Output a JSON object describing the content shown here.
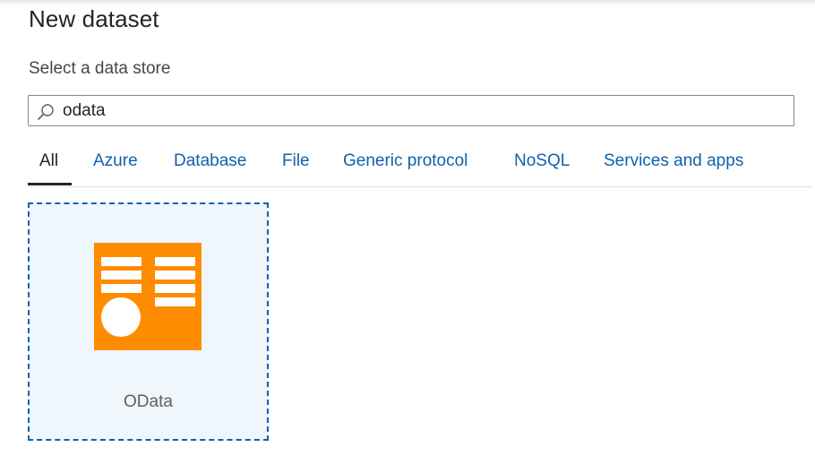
{
  "dialog": {
    "title": "New dataset",
    "subtitle": "Select a data store"
  },
  "search": {
    "value": "odata",
    "icon": "search-icon"
  },
  "tabs": [
    {
      "label": "All",
      "active": true
    },
    {
      "label": "Azure",
      "active": false
    },
    {
      "label": "Database",
      "active": false
    },
    {
      "label": "File",
      "active": false
    },
    {
      "label": "Generic protocol",
      "active": false
    },
    {
      "label": "NoSQL",
      "active": false
    },
    {
      "label": "Services and apps",
      "active": false
    }
  ],
  "results": [
    {
      "label": "OData",
      "icon": "odata-icon",
      "icon_color": "#ff8c00",
      "selected": true
    }
  ],
  "colors": {
    "accent": "#0f62ad",
    "card_selected_bg": "#eff6fc",
    "odata_orange": "#ff8c00"
  }
}
